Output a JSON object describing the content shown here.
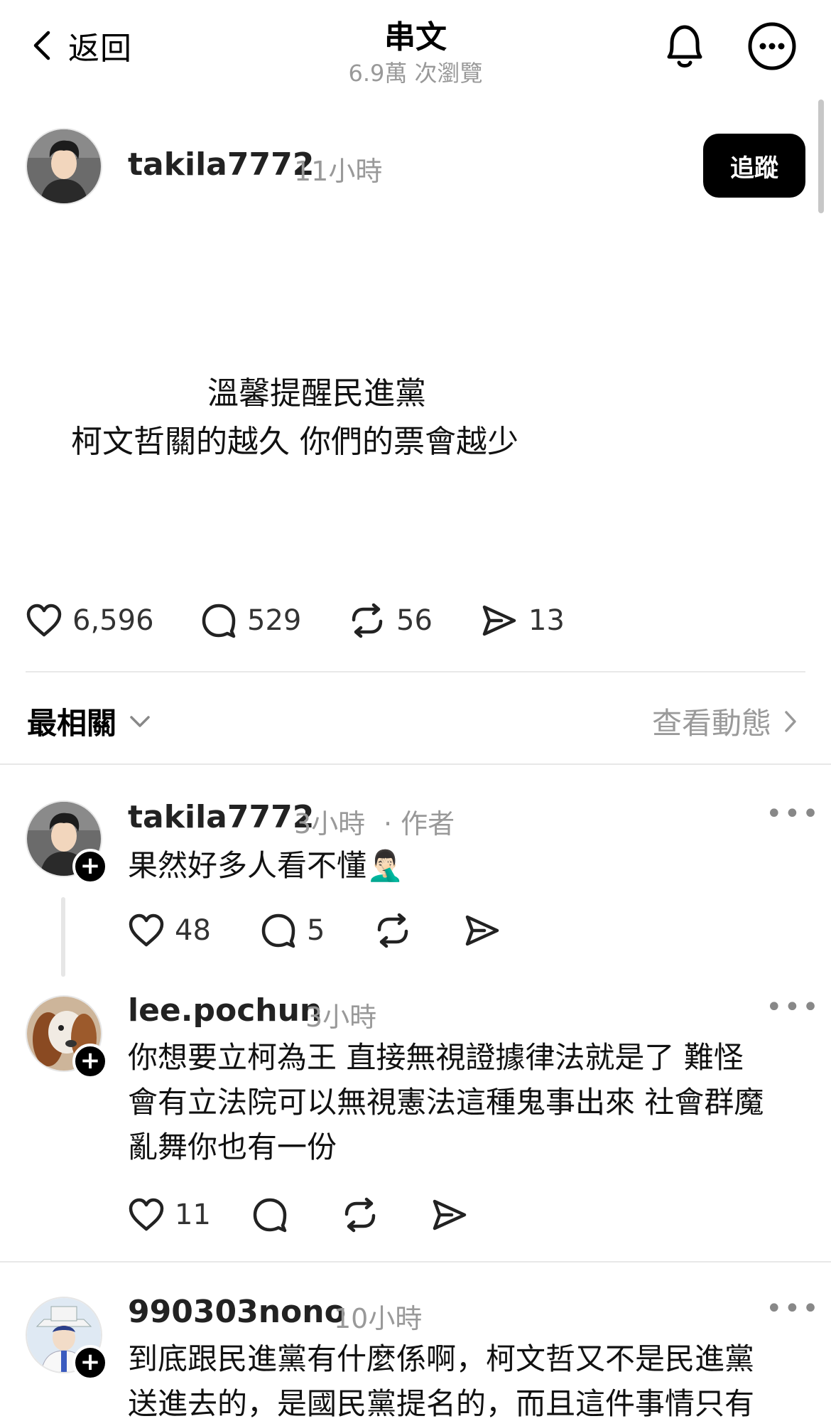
{
  "header": {
    "back_label": "返回",
    "title": "串文",
    "subtitle": "6.9萬 次瀏覽"
  },
  "post": {
    "username": "takila7772",
    "time": "11小時",
    "follow_label": "追蹤",
    "lines": [
      "溫馨提醒民進黨",
      "柯文哲關的越久 你們的票會越少"
    ],
    "likes": "6,596",
    "comments": "529",
    "reposts": "56",
    "shares": "13"
  },
  "sort": {
    "label": "最相關",
    "activity_label": "查看動態"
  },
  "replies": [
    {
      "username": "takila7772",
      "time": "3小時",
      "tag": "· 作者",
      "text": "果然好多人看不懂🤦🏻‍♂️",
      "likes": "48",
      "comments": "5"
    },
    {
      "username": "lee.pochun",
      "time": "3小時",
      "text_lines": [
        "你想要立柯為王 直接無視證據律法就是了  難怪",
        "會有立法院可以無視憲法這種鬼事出來 社會群魔",
        "亂舞你也有一份"
      ],
      "likes": "11"
    },
    {
      "username": "990303nono",
      "time": "10小時",
      "text_lines": [
        "到底跟民進黨有什麼係啊，柯文哲又不是民進黨",
        "送進去的，是國民黨提名的，而且這件事情只有"
      ]
    }
  ],
  "icons": {
    "back": "chevron-left-icon",
    "bell": "bell-icon",
    "more": "more-horizontal-icon",
    "like": "heart-icon",
    "comment": "comment-icon",
    "repost": "repost-icon",
    "share": "send-icon"
  },
  "colors": {
    "follow_bg": "#000000",
    "muted": "#999999"
  }
}
